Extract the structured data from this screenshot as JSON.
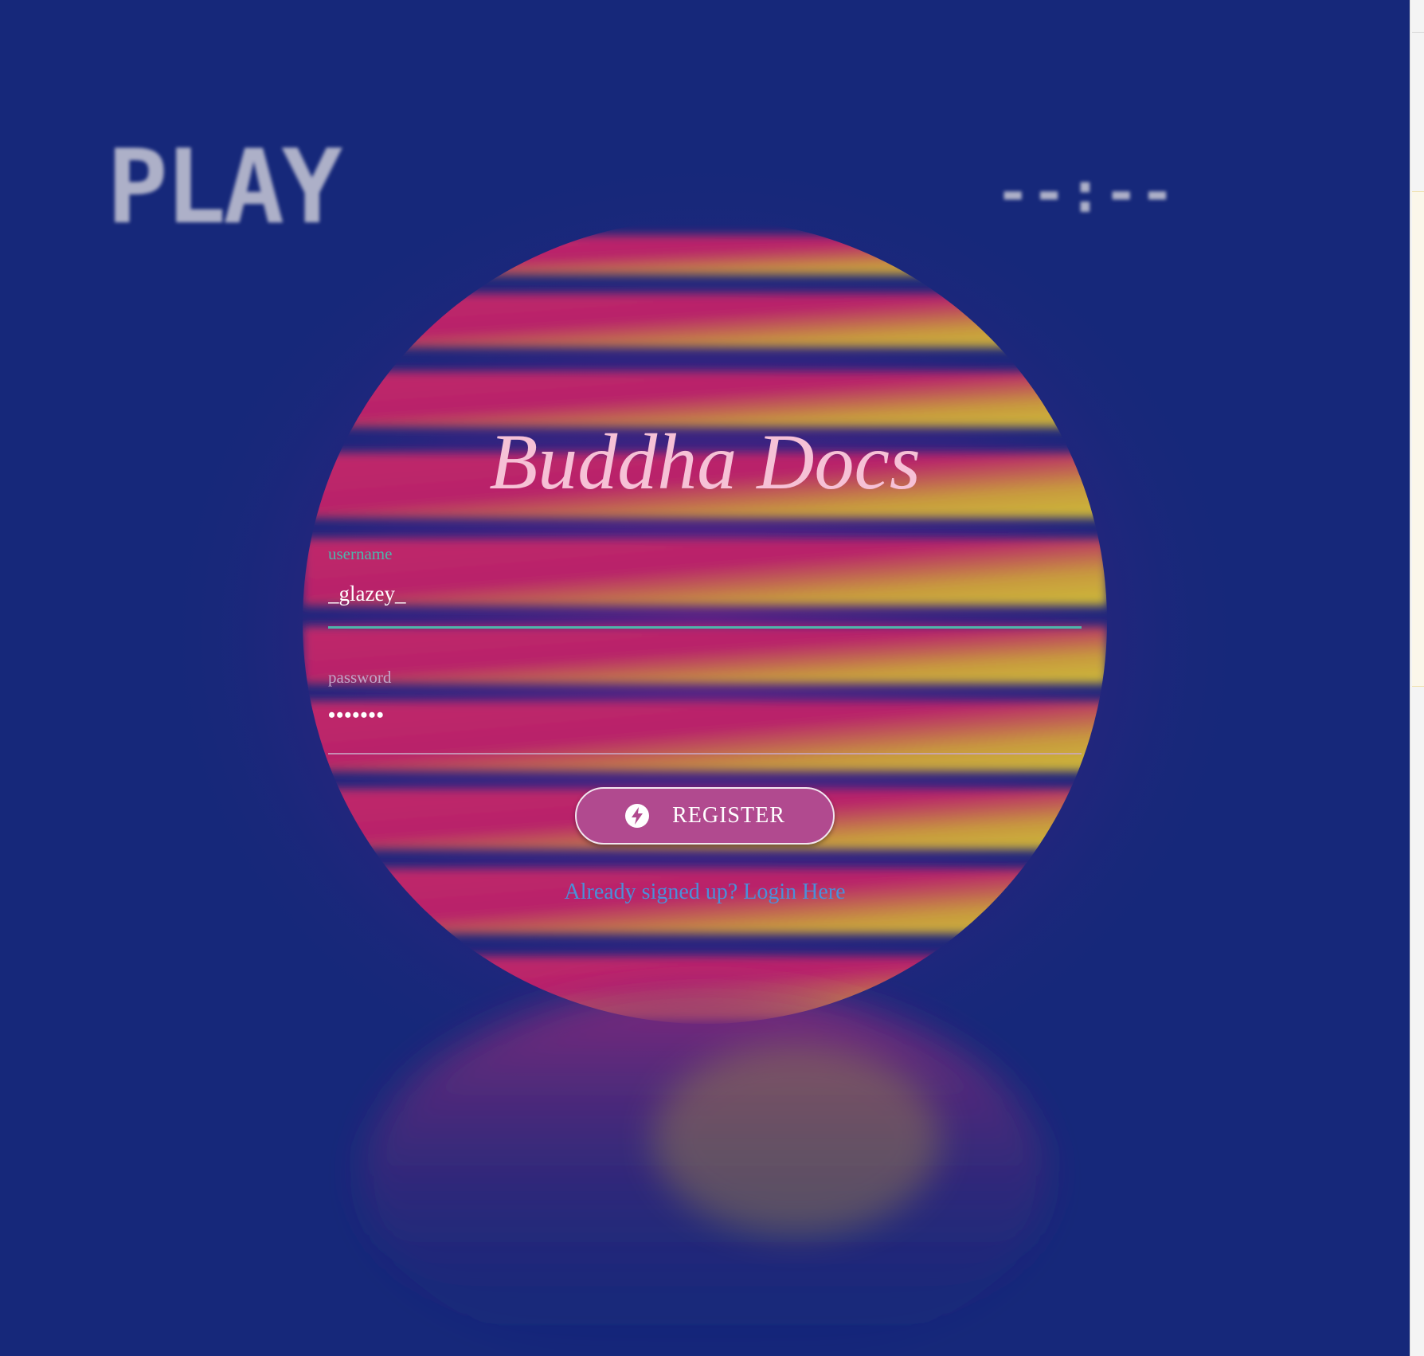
{
  "background": {
    "overlay_left": "PLAY",
    "overlay_right": "--:--",
    "colors": {
      "sky": "#16287a",
      "sun_magenta": "#b8246a",
      "sun_yellow": "#c9b53a"
    }
  },
  "app": {
    "title": "Buddha Docs"
  },
  "form": {
    "username": {
      "label": "username",
      "value": "_glazey_"
    },
    "password": {
      "label": "password",
      "value": "•••••••"
    },
    "register_button": {
      "label": "REGISTER",
      "icon": "lightning-bolt-icon"
    },
    "login_link": "Already signed up? Login Here"
  },
  "colors": {
    "title": "#f6c1d6",
    "username_label": "#4db6ac",
    "password_label": "#c2a5c8",
    "button": "#b14a8f",
    "link": "#4a90d9"
  }
}
